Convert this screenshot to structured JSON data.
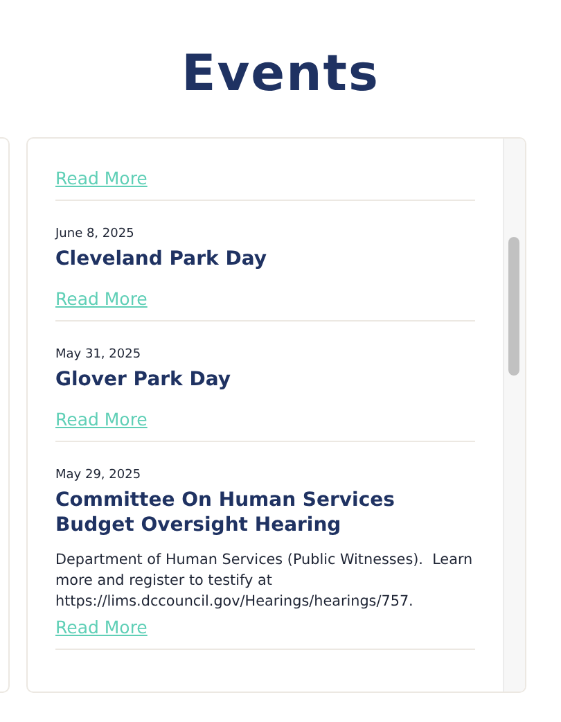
{
  "heading": "Events",
  "events": [
    {
      "link": "Read More"
    },
    {
      "date": "June 8, 2025",
      "title": "Cleveland Park Day",
      "link": "Read More"
    },
    {
      "date": "May 31, 2025",
      "title": "Glover Park Day",
      "link": "Read More"
    },
    {
      "date": "May 29, 2025",
      "title": "Committee On Human Services Budget Oversight Hearing",
      "description": "Department of Human Services (Public Witnesses).  Learn more and register to testify at https://lims.dccouncil.gov/Hearings/hearings/757.",
      "link": "Read More"
    }
  ]
}
